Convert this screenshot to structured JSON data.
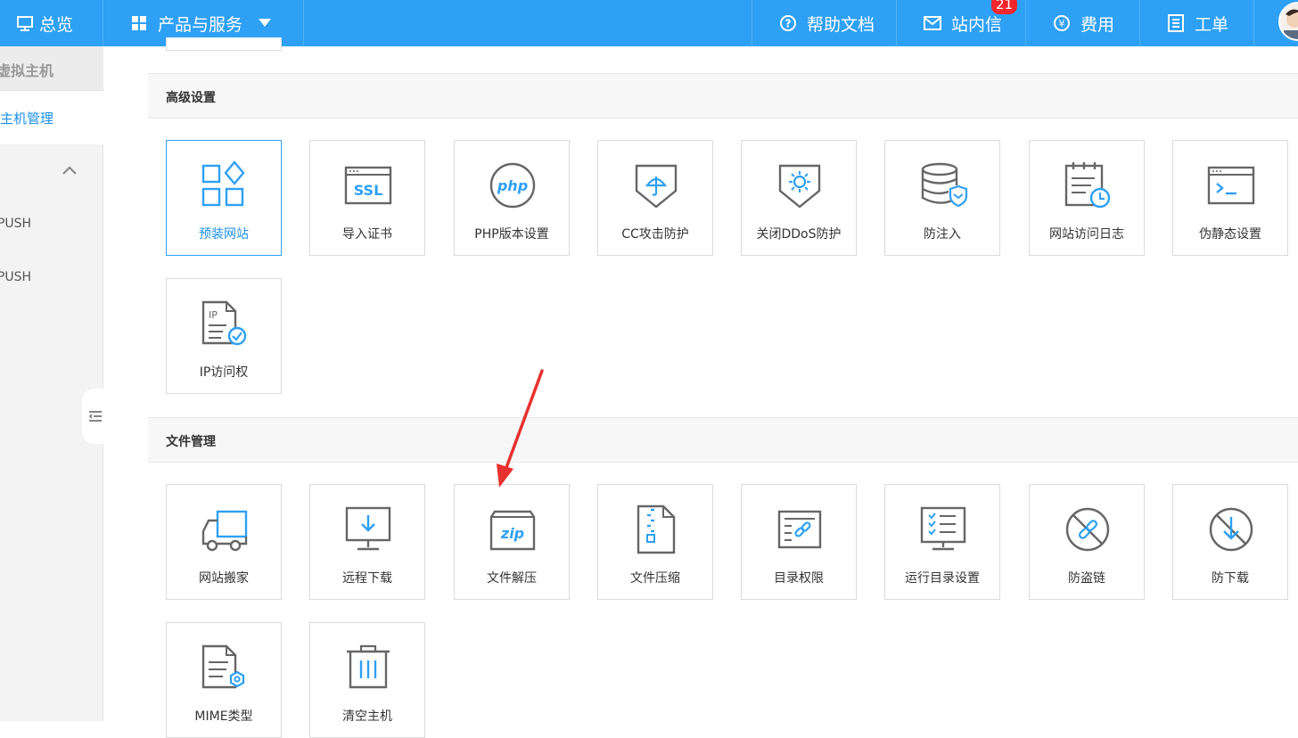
{
  "topbar": {
    "overview": "总览",
    "products": "产品与服务",
    "help": "帮助文档",
    "messages": "站内信",
    "messages_badge": "21",
    "fees": "费用",
    "tickets": "工单"
  },
  "sidebar": {
    "title": "虚拟主机",
    "active_item": "主机管理",
    "items": [
      "PUSH",
      "PUSH"
    ]
  },
  "sections": {
    "advanced": {
      "title": "高级设置",
      "tiles": [
        {
          "label": "预装网站",
          "icon": "apps-grid-icon"
        },
        {
          "label": "导入证书",
          "icon": "ssl-certificate-icon"
        },
        {
          "label": "PHP版本设置",
          "icon": "php-icon"
        },
        {
          "label": "CC攻击防护",
          "icon": "umbrella-shield-icon"
        },
        {
          "label": "关闭DDoS防护",
          "icon": "virus-shield-icon"
        },
        {
          "label": "防注入",
          "icon": "database-shield-icon"
        },
        {
          "label": "网站访问日志",
          "icon": "log-clock-icon"
        },
        {
          "label": "伪静态设置",
          "icon": "terminal-window-icon"
        },
        {
          "label": "IP访问权",
          "icon": "ip-document-icon"
        }
      ]
    },
    "files": {
      "title": "文件管理",
      "tiles": [
        {
          "label": "网站搬家",
          "icon": "moving-truck-icon"
        },
        {
          "label": "远程下载",
          "icon": "monitor-download-icon"
        },
        {
          "label": "文件解压",
          "icon": "zip-box-icon"
        },
        {
          "label": "文件压缩",
          "icon": "zip-file-icon"
        },
        {
          "label": "目录权限",
          "icon": "directory-link-icon"
        },
        {
          "label": "运行目录设置",
          "icon": "checklist-monitor-icon"
        },
        {
          "label": "防盗链",
          "icon": "no-link-icon"
        },
        {
          "label": "防下载",
          "icon": "no-download-icon"
        },
        {
          "label": "MIME类型",
          "icon": "mime-document-icon"
        },
        {
          "label": "清空主机",
          "icon": "trash-icon"
        }
      ]
    }
  },
  "colors": {
    "topbar": "#2ea0f5",
    "accent": "#1b8fe8",
    "icon_gray": "#666666",
    "icon_blue": "#2ea0f5",
    "badge": "#f0262c",
    "annotation_arrow": "#e8322f"
  }
}
